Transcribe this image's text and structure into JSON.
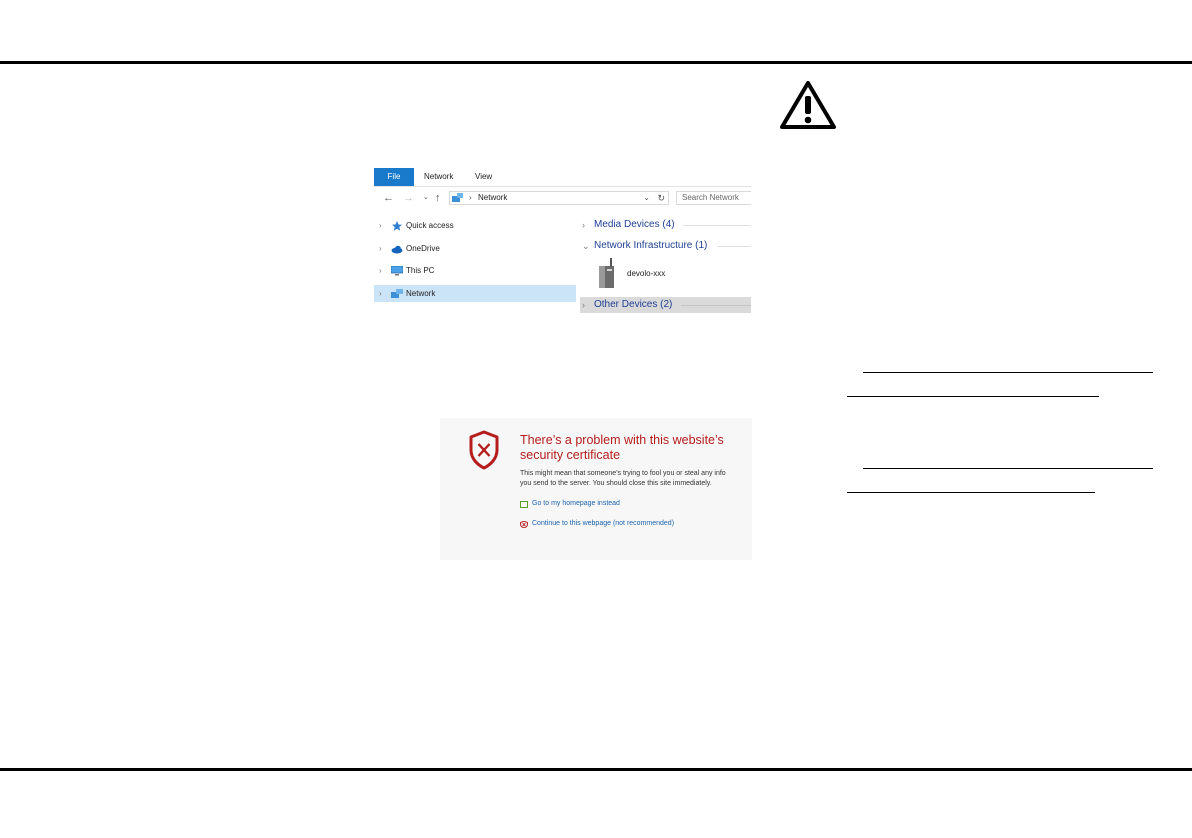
{
  "explorer": {
    "ribbon_tabs": [
      "File",
      "Network",
      "View"
    ],
    "address_text": "Network",
    "search_placeholder": "Search Network",
    "sidebar": [
      {
        "label": "Quick access",
        "icon": "star-icon"
      },
      {
        "label": "OneDrive",
        "icon": "cloud-icon"
      },
      {
        "label": "This PC",
        "icon": "computer-icon"
      },
      {
        "label": "Network",
        "icon": "network-icon",
        "selected": true
      }
    ],
    "groups": [
      {
        "label": "Media Devices (4)",
        "expanded": false
      },
      {
        "label": "Network Infrastructure (1)",
        "expanded": true
      },
      {
        "label": "Other Devices (2)",
        "expanded": false
      }
    ],
    "device_label": "devolo-xxx"
  },
  "cert": {
    "title_line1": "There’s a problem with this website’s",
    "title_line2": "security certificate",
    "desc_line1": "This might mean that someone’s trying to fool you or steal any info",
    "desc_line2": "you send to the server. You should close this site immediately.",
    "link_home": "Go to my homepage instead",
    "link_continue": "Continue to this webpage (not recommended)"
  },
  "colors": {
    "file_tab": "#1979ca",
    "selected_item": "#cce4f7",
    "group_text": "#1e3f94",
    "cert_title": "#b51d1d",
    "cert_link": "#1a64b0"
  }
}
